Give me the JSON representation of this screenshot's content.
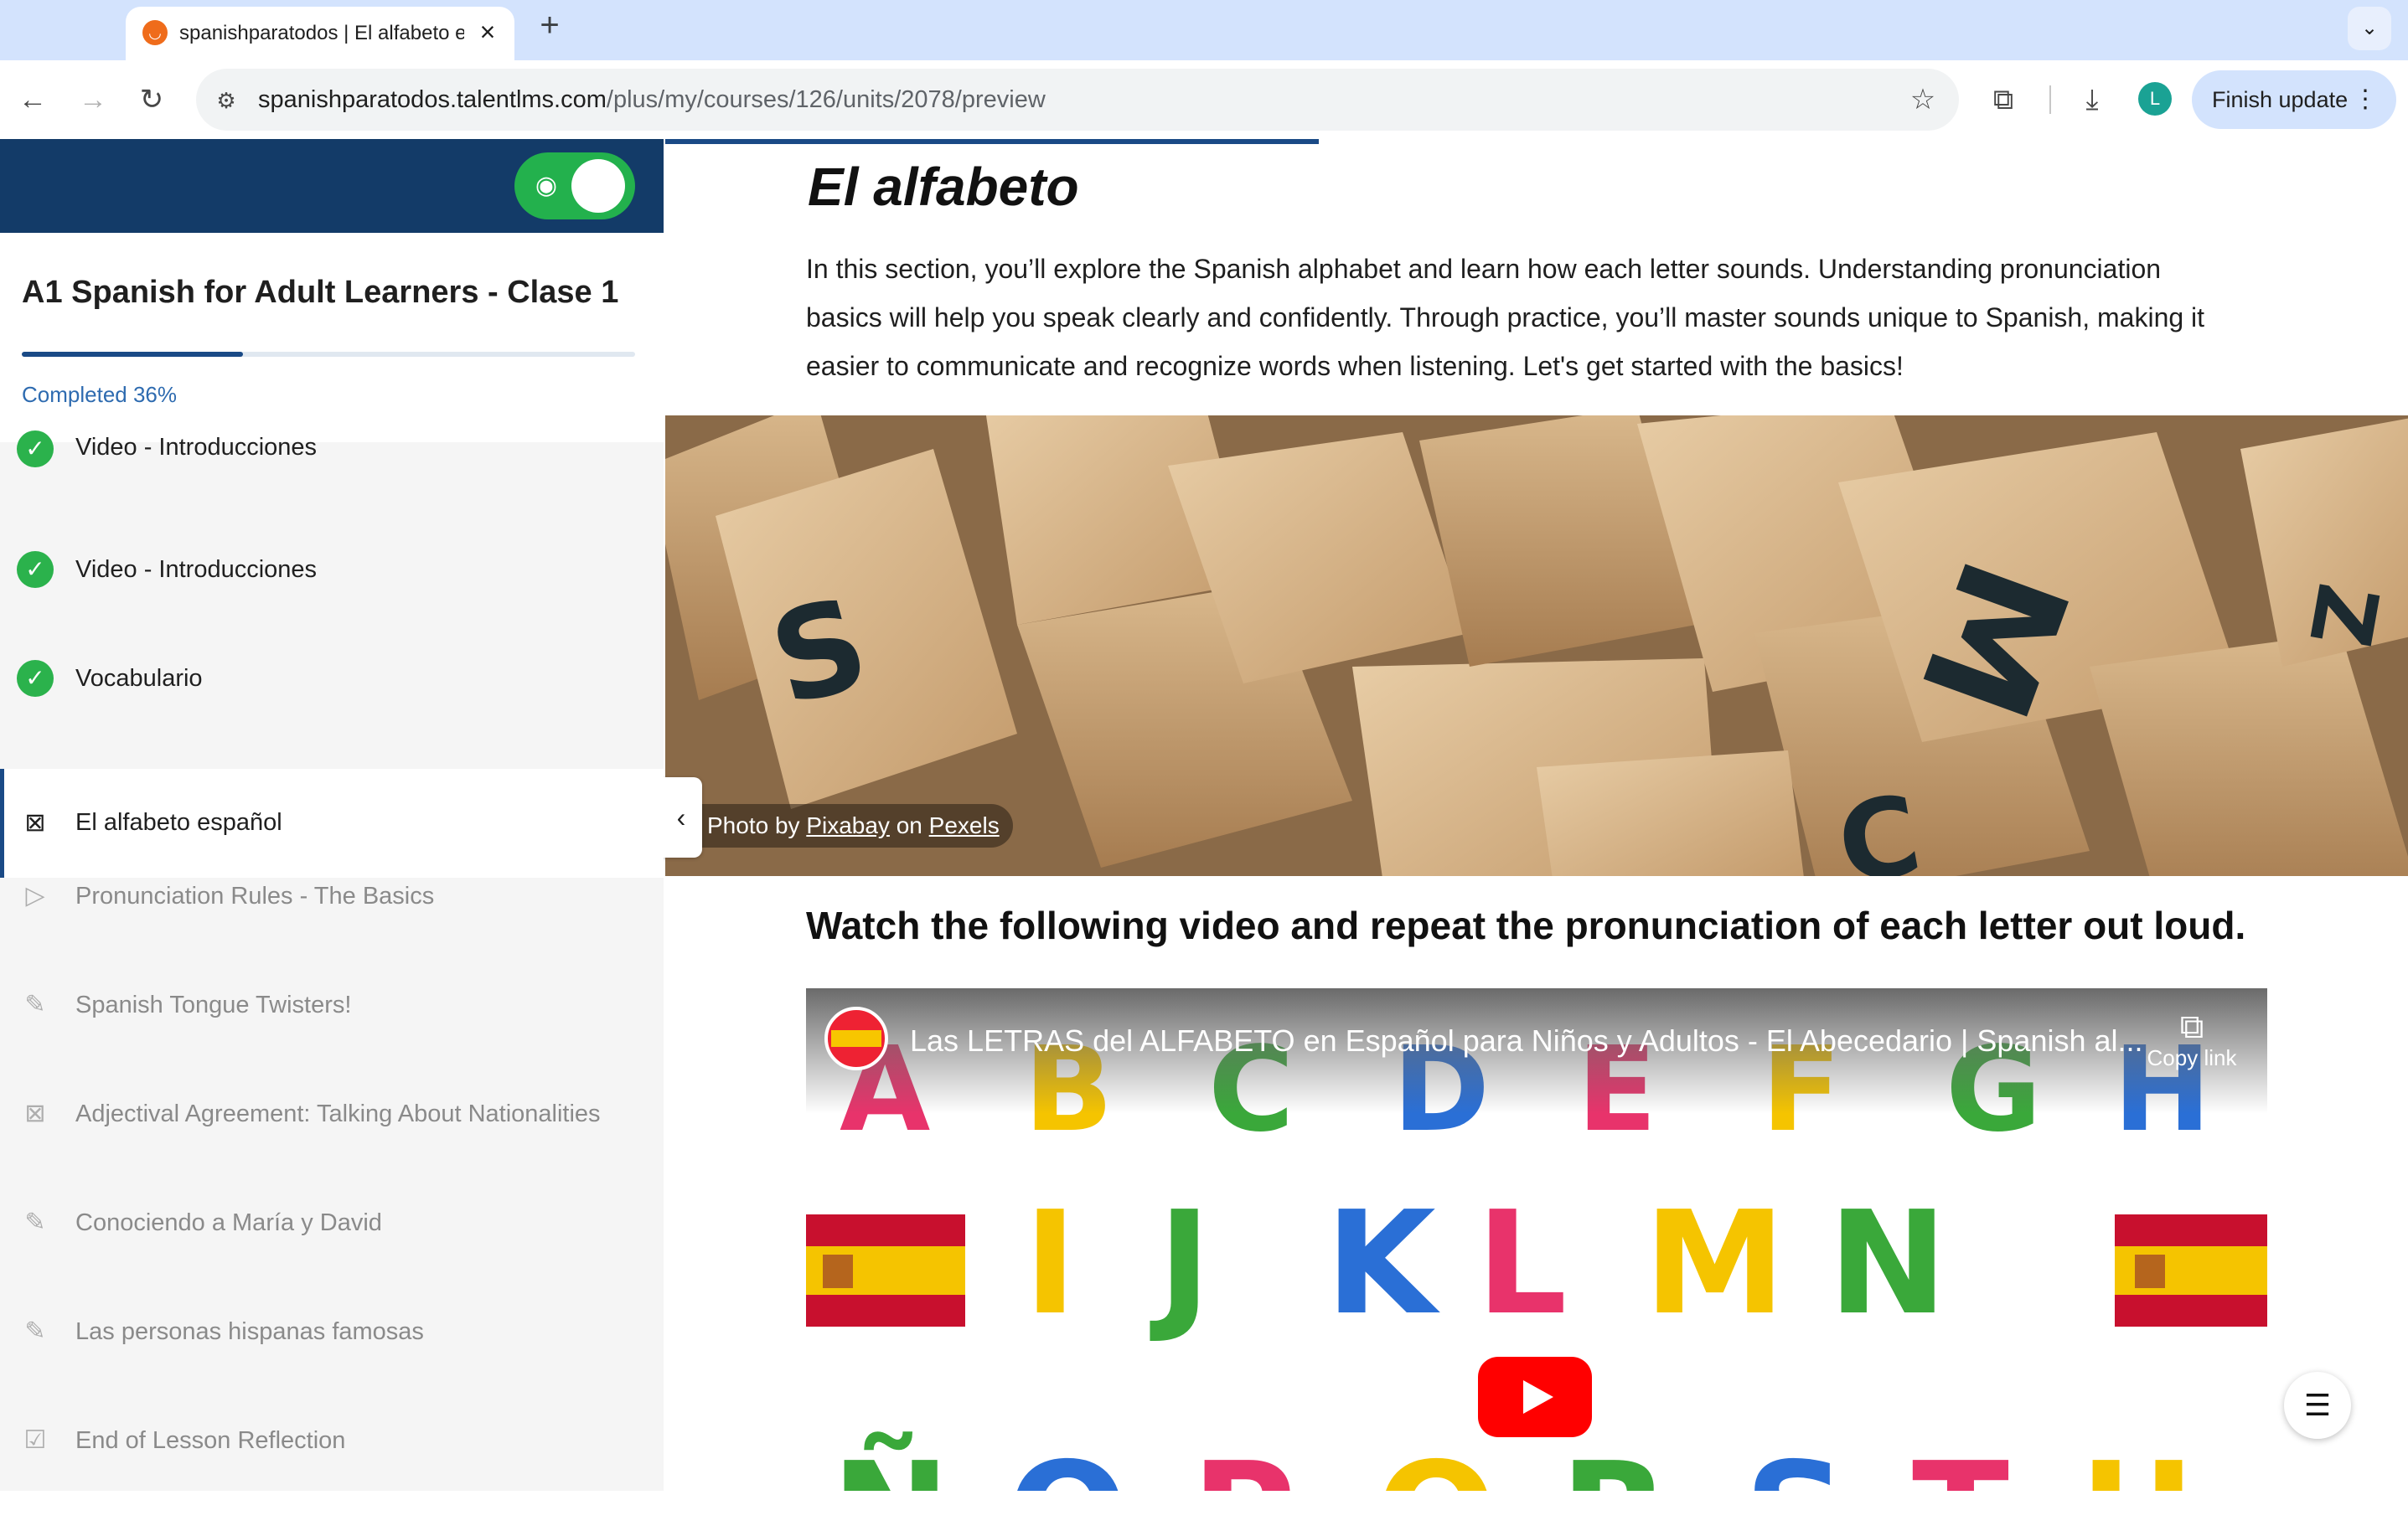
{
  "browser": {
    "tab_title": "spanishparatodos | El alfabeto español",
    "tab_favicon": "smile-favicon",
    "new_tab_label": "+",
    "close_tab_label": "×",
    "url_host": "spanishparatodos.talentlms.com",
    "url_path": "/plus/my/courses/126/units/2078/preview",
    "profile_initial": "L",
    "finish_update_label": "Finish update"
  },
  "sidebar": {
    "course_title": "A1 Spanish for Adult Learners - Clase 1",
    "progress_percent": 36,
    "completed_label": "Completed 36%",
    "units": [
      {
        "label": "Video - Introducciones",
        "state": "done",
        "icon": "check-icon"
      },
      {
        "label": "Video - Introducciones",
        "state": "done",
        "icon": "check-icon"
      },
      {
        "label": "Vocabulario",
        "state": "done",
        "icon": "check-icon"
      },
      {
        "label": "El alfabeto español",
        "state": "active",
        "icon": "presentation-icon"
      },
      {
        "label": "Pronunciation Rules - The Basics",
        "state": "locked",
        "icon": "play-icon"
      },
      {
        "label": "Spanish Tongue Twisters!",
        "state": "locked",
        "icon": "pencil-icon"
      },
      {
        "label": "Adjectival Agreement: Talking About Nationalities",
        "state": "locked",
        "icon": "presentation-icon"
      },
      {
        "label": "Conociendo a María y David",
        "state": "locked",
        "icon": "pencil-icon"
      },
      {
        "label": "Las personas hispanas famosas",
        "state": "locked",
        "icon": "pencil-icon"
      },
      {
        "label": "End of Lesson Reflection",
        "state": "locked",
        "icon": "chat-check-icon"
      }
    ]
  },
  "content": {
    "title": "El alfabeto",
    "intro": "In this section, you’ll explore the Spanish alphabet and learn how each letter sounds. Understanding pronunciation basics will help you speak clearly and confidently. Through practice, you’ll master sounds unique to Spanish, making it easier to communicate and recognize words when listening. Let's get started with the basics!",
    "credit_prefix": "Photo by",
    "credit_author": "Pixabay",
    "credit_mid": "on",
    "credit_site": "Pexels",
    "subheading": "Watch the following video and repeat the pronunciation of each letter out loud.",
    "video": {
      "title": "Las LETRAS del ALFABETO en Español para Niños y Adultos - El Abecedario | Spanish al...",
      "copy_link_label": "Copy link",
      "row1_letters": [
        "A",
        "B",
        "C",
        "D",
        "E",
        "F",
        "G",
        "H"
      ],
      "row2_letters": [
        "I",
        "J",
        "K",
        "L",
        "M",
        "N"
      ],
      "row3_letters": [
        "Ñ",
        "O",
        "P",
        "Q",
        "R",
        "S",
        "T",
        "U"
      ]
    }
  },
  "colors": {
    "sidebar_header": "#133b68",
    "toggle_on": "#23b14d",
    "progress": "#1a4a86",
    "check": "#2bb24c"
  }
}
